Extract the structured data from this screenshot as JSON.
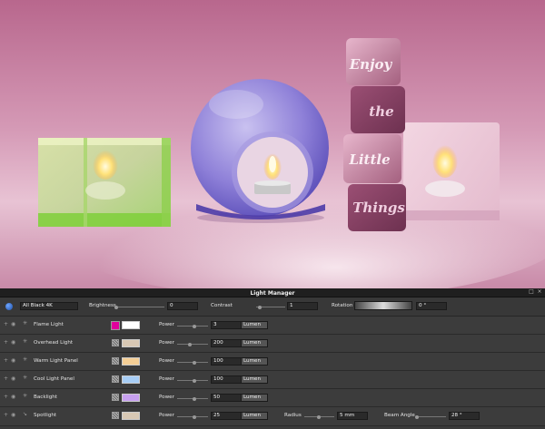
{
  "panel": {
    "title": "Light Manager",
    "environment": {
      "preset": "All Black 4K",
      "brightness_label": "Brightness",
      "brightness_value": "0",
      "contrast_label": "Contrast",
      "contrast_value": "1",
      "rotation_label": "Rotation",
      "rotation_value": "0 °"
    },
    "lights": [
      {
        "name": "Flame Light",
        "color": "#ffffff",
        "swatch": "#e0009c",
        "power_label": "Power",
        "power": "3",
        "unit": "Lumen"
      },
      {
        "name": "Overhead Light",
        "color": "#d8c8b4",
        "power_label": "Power",
        "power": "200",
        "unit": "Lumen"
      },
      {
        "name": "Warm Light Panel",
        "color": "#f5cf96",
        "power_label": "Power",
        "power": "100",
        "unit": "Lumen"
      },
      {
        "name": "Cool Light Panel",
        "color": "#a7cdf5",
        "power_label": "Power",
        "power": "100",
        "unit": "Lumen"
      },
      {
        "name": "Backlight",
        "color": "#c7a0f0",
        "power_label": "Power",
        "power": "50",
        "unit": "Lumen"
      },
      {
        "name": "Spotlight",
        "color": "#d8c8b4",
        "power_label": "Power",
        "power": "25",
        "unit": "Lumen",
        "radius_label": "Radius",
        "radius": "5 mm",
        "beam_label": "Beam Angle",
        "beam": "28 °"
      }
    ]
  },
  "scene": {
    "words": [
      "Enjoy",
      "the",
      "Little",
      "Things"
    ]
  }
}
